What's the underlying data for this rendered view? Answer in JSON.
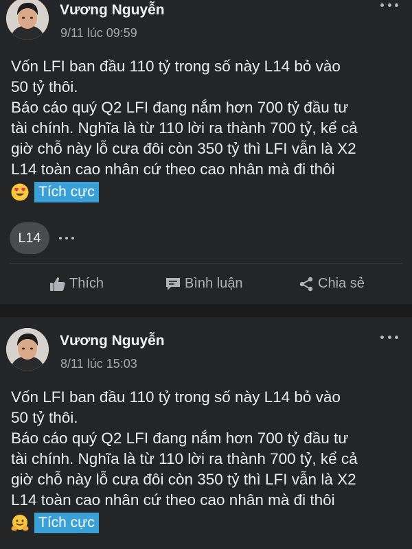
{
  "posts": [
    {
      "author": "Vương Nguyễn",
      "time": "9/11 lúc 09:59",
      "lines": [
        "Vốn LFI ban đầu 110 tỷ trong số này L14 bỏ vào",
        "50 tỷ thôi.",
        "Báo cáo quý Q2 LFI đang nắm hơn 700 tỷ đầu tư",
        "tài chính. Nghĩa là từ 110 lời ra thành 700 tỷ, kể cả",
        "giờ chỗ này lỗ cưa đôi còn 350 tỷ thì LFI vẫn là X2",
        "L14 toàn cao nhân cứ theo cao nhân mà đi thôi"
      ],
      "emoji": "heart-eyes-emoji",
      "tag": "Tích cực",
      "reaction_label": "L14"
    },
    {
      "author": "Vương Nguyễn",
      "time": "8/11 lúc 15:03",
      "lines": [
        "Vốn LFI ban đầu 110 tỷ trong số này L14 bỏ vào",
        "50 tỷ thôi.",
        "Báo cáo quý Q2 LFI đang nắm hơn 700 tỷ đầu tư",
        "tài chính. Nghĩa là từ 110 lời ra thành 700 tỷ, kể cả",
        "giờ chỗ này lỗ cưa đôi còn 350 tỷ thì LFI vẫn là X2",
        "L14 toàn cao nhân cứ theo cao nhân mà đi thôi"
      ],
      "emoji": "hugging-emoji",
      "tag": "Tích cực"
    }
  ],
  "actions": {
    "like": "Thích",
    "comment": "Bình luận",
    "share": "Chia sẻ"
  },
  "colors": {
    "page_bg": "#1b1b1b",
    "card_bg": "#242526",
    "tag_bg": "#3aa0d8",
    "muted_text": "#b0b3b8"
  }
}
